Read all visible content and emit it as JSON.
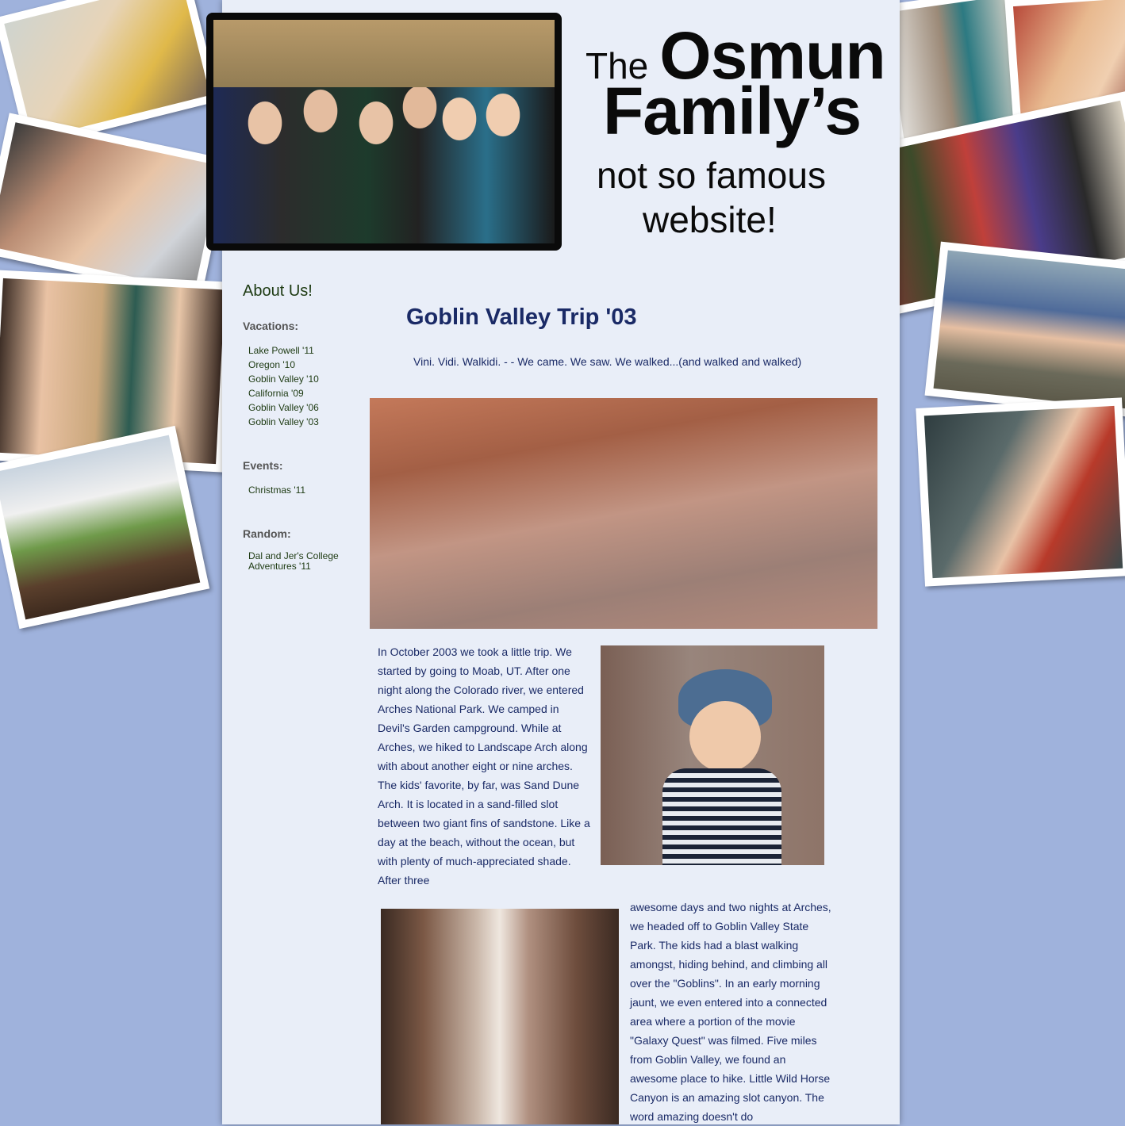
{
  "site": {
    "title_the": "The",
    "title_osmun": "Osmun",
    "title_family": "Family’s",
    "title_sub1": "not so famous",
    "title_sub2": "website!"
  },
  "sidebar": {
    "about_link": "About Us!",
    "vacations_heading": "Vacations:",
    "vacations": [
      "Lake Powell '11",
      "Oregon '10",
      "Goblin Valley '10",
      "California '09",
      "Goblin Valley '06",
      "Goblin Valley '03"
    ],
    "events_heading": "Events:",
    "events": [
      "Christmas '11"
    ],
    "random_heading": "Random:",
    "random": [
      "Dal and Jer's College Adventures '11"
    ]
  },
  "article": {
    "title": "Goblin Valley Trip '03",
    "tagline": "Vini. Vidi. Walkidi. - - We came. We saw. We walked...(and walked and walked)",
    "para1": "In October 2003 we took a little trip. We started by going to Moab, UT. After one night along the Colorado river, we entered Arches National Park. We camped in Devil's Garden campground. While at Arches, we hiked to Landscape Arch along with about another eight or nine arches. The kids' favorite, by far, was Sand Dune Arch. It is located in a sand-filled slot between two giant fins of sandstone. Like a day at the beach, without the ocean, but with plenty of much-appreciated shade. After three",
    "para2": "awesome days and two nights at Arches, we headed off to Goblin Valley State Park. The kids had a blast walking amongst, hiding behind, and climbing all over the \"Goblins\". In an early morning jaunt, we even entered into a connected area where a portion of the movie \"Galaxy Quest\" was filmed. Five miles from Goblin Valley, we found an awesome place to hike. Little Wild Horse Canyon is an amazing slot canyon. The word amazing doesn't do"
  },
  "colors": {
    "background": "#9fb2dc",
    "page": "#e9eef8",
    "link_green": "#1d3a12",
    "article_blue": "#1a2a66"
  }
}
